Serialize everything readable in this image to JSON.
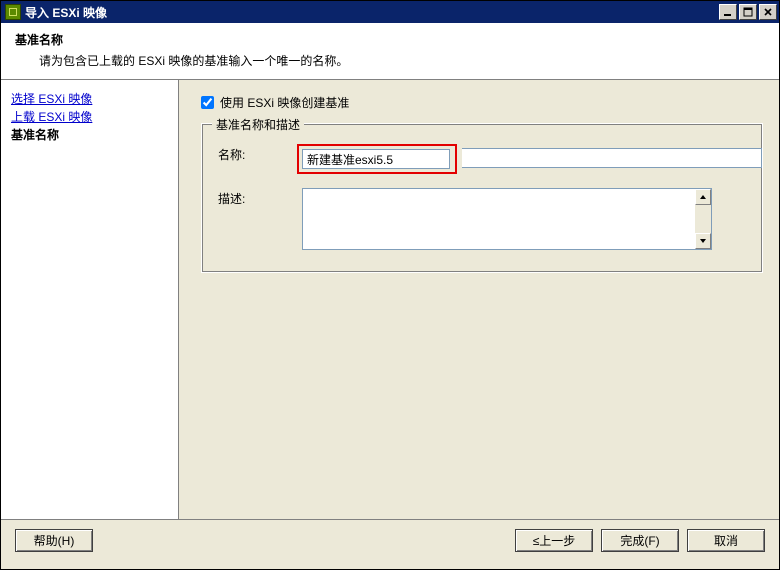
{
  "window": {
    "title": "导入 ESXi 映像"
  },
  "header": {
    "title": "基准名称",
    "subtitle": "请为包含已上载的 ESXi 映像的基准输入一个唯一的名称。"
  },
  "sidebar": {
    "items": [
      {
        "label": "选择 ESXi 映像",
        "active": false
      },
      {
        "label": "上载 ESXi 映像",
        "active": false
      },
      {
        "label": "基准名称",
        "active": true
      }
    ]
  },
  "content": {
    "checkbox_label": "使用 ESXi 映像创建基准",
    "checkbox_checked": true,
    "group_title": "基准名称和描述",
    "name_label": "名称:",
    "name_value": "新建基准esxi5.5",
    "desc_label": "描述:",
    "desc_value": ""
  },
  "footer": {
    "help": "帮助(H)",
    "back": "≤上一步",
    "finish": "完成(F)",
    "cancel": "取消"
  }
}
